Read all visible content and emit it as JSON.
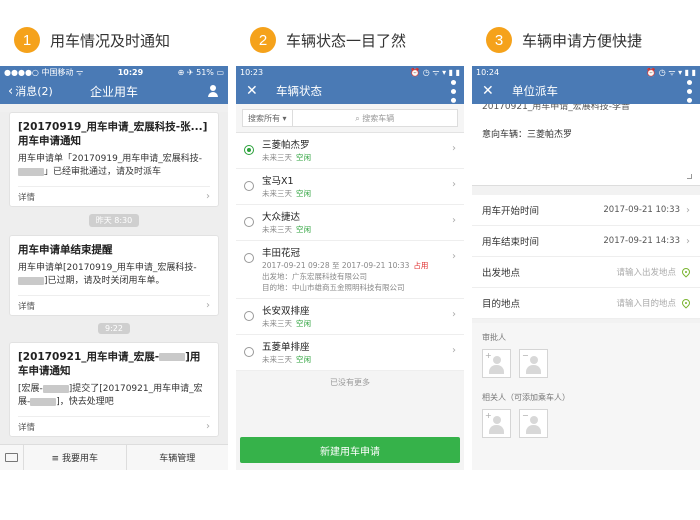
{
  "steps": [
    {
      "num": "1",
      "title": "用车情况及时通知"
    },
    {
      "num": "2",
      "title": "车辆状态一目了然"
    },
    {
      "num": "3",
      "title": "车辆申请方便快捷"
    }
  ],
  "phone1": {
    "status": {
      "carrier": "●●●●○ 中国移动 ᯤ",
      "time": "10:29",
      "battery": "⊕ ✈ 51% ▭"
    },
    "back_label": "消息(2)",
    "title": "企业用车",
    "cards": [
      {
        "title": "[20170919_用车申请_宏展科技-张...]用车申请通知",
        "text_a": "用车申请单「20170919_用车申请_宏展科技-",
        "text_b": "」已经审批通过，请及时派车",
        "detail": "详情"
      },
      {
        "title": "用车申请单结束提醒",
        "text_a": "用车申请单[20170919_用车申请_宏展科技-",
        "text_b": "]已过期，请及时关闭用车单。",
        "detail": "详情"
      },
      {
        "title": "[20170921_用车申请_宏展-",
        "title_b": "]用车申请通知",
        "text_a": "[宏展-",
        "text_b": "]提交了[20170921_用车申请_宏展-",
        "text_c": "]，快去处理吧",
        "detail": "详情"
      }
    ],
    "times": [
      "昨天 8:30",
      "9:22"
    ],
    "tabs": [
      "≡ 我要用车",
      "车辆管理"
    ]
  },
  "phone2": {
    "status": {
      "time": "10:23",
      "icons": "⏰ ◷ ᯤ ▾ ▮ ▮"
    },
    "title": "车辆状态",
    "search_scope": "搜索所有 ▾",
    "search_placeholder": "⌕ 搜索车辆",
    "cars": [
      {
        "name": "三菱帕杰罗",
        "sub": "未来三天",
        "status": "空闲",
        "used": false,
        "selected": true
      },
      {
        "name": "宝马X1",
        "sub": "未来三天",
        "status": "空闲",
        "used": false,
        "selected": false
      },
      {
        "name": "大众捷达",
        "sub": "未来三天",
        "status": "空闲",
        "used": false,
        "selected": false
      },
      {
        "name": "丰田花冠",
        "sub": "2017-09-21 09:28 至 2017-09-21 10:33",
        "status": "占用",
        "used": true,
        "selected": false,
        "from": "出发地：广东宏展科技有限公司",
        "to": "目的地：中山市雄商五金照明科技有限公司"
      },
      {
        "name": "长安双排座",
        "sub": "未来三天",
        "status": "空闲",
        "used": false,
        "selected": false
      },
      {
        "name": "五菱单排座",
        "sub": "未来三天",
        "status": "空闲",
        "used": false,
        "selected": false
      }
    ],
    "no_more": "已没有更多",
    "new_button": "新建用车申请"
  },
  "phone3": {
    "status": {
      "time": "10:24",
      "icons": "⏰ ◷ ᯤ ▾ ▮ ▮"
    },
    "title": "单位派车",
    "cut_text": "20170921_用车申请_宏展科技-李晋",
    "intent": "意向车辆：三菱帕杰罗",
    "rows": [
      {
        "label": "用车开始时间",
        "value": "2017-09-21 10:33"
      },
      {
        "label": "用车结束时间",
        "value": "2017-09-21 14:33"
      }
    ],
    "loc_rows": [
      {
        "label": "出发地点",
        "placeholder": "请输入出发地点"
      },
      {
        "label": "目的地点",
        "placeholder": "请输入目的地点"
      }
    ],
    "approver_label": "审批人",
    "related_label": "相关人（可添加乘车人）"
  }
}
